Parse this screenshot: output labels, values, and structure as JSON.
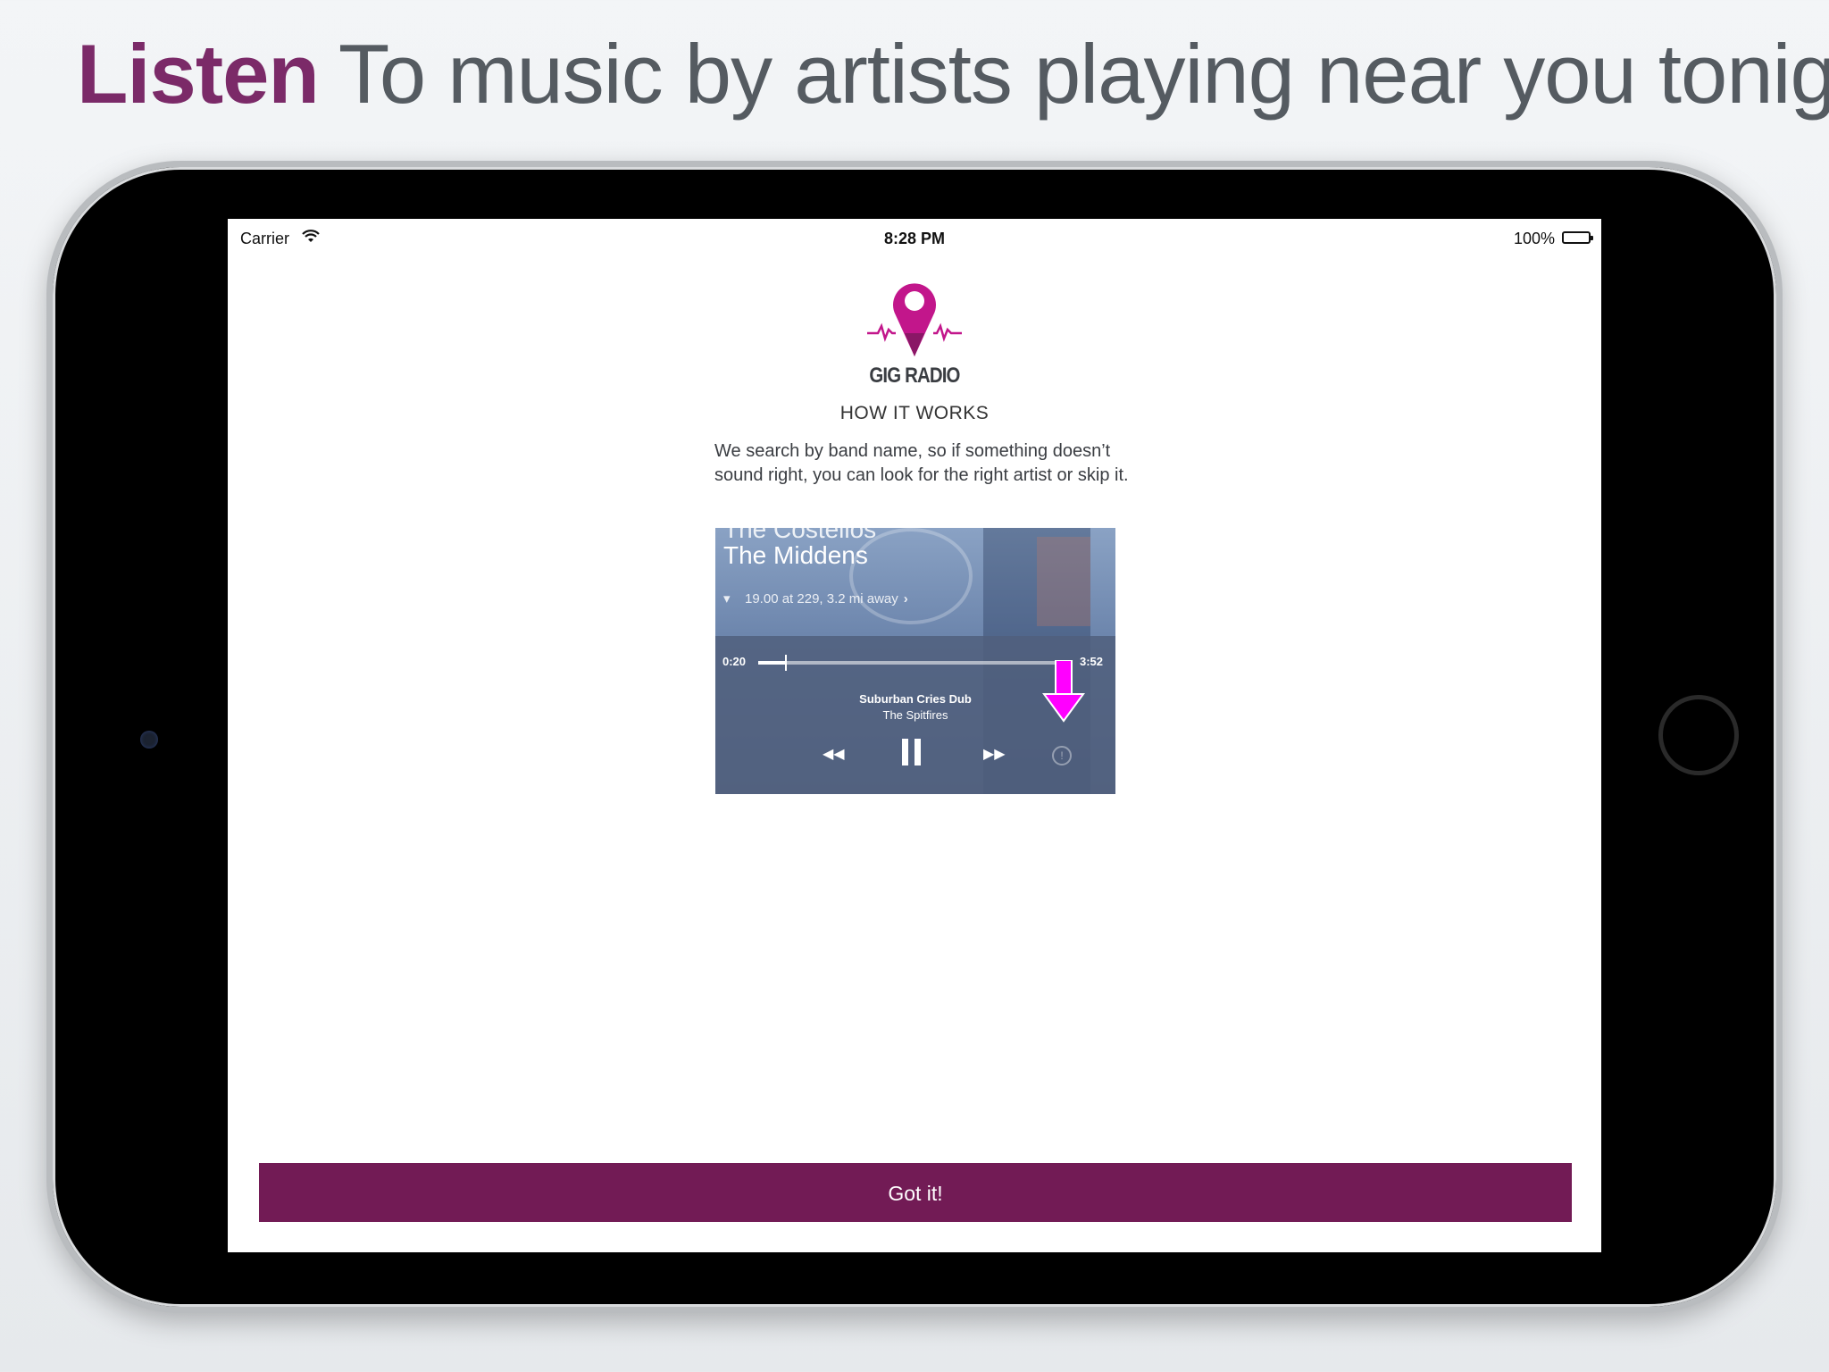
{
  "headline": {
    "emphasis": "Listen",
    "text": "To music by artists playing near you tonight"
  },
  "status_bar": {
    "carrier": "Carrier",
    "time": "8:28 PM",
    "battery": "100%"
  },
  "app": {
    "logo_text": "GIG RADIO",
    "section_title": "HOW IT WORKS",
    "description": "We search by band name, so if something doesn’t sound right, you can look for the right artist or skip it."
  },
  "player": {
    "previous_band": "The Costellos",
    "band": "The Middens",
    "gig_info": "19.00 at 229, 3.2 mi away",
    "elapsed": "0:20",
    "duration": "3:52",
    "progress": 0.086,
    "track_title": "Suburban Cries Dub",
    "track_artist": "The  Spitfires",
    "info_label": "!"
  },
  "button": {
    "label": "Got it!"
  },
  "colors": {
    "brand": "#721b55",
    "headline_accent": "#7b2a68",
    "logo_pink": "#c2168b",
    "arrow": "#ff00ff"
  }
}
